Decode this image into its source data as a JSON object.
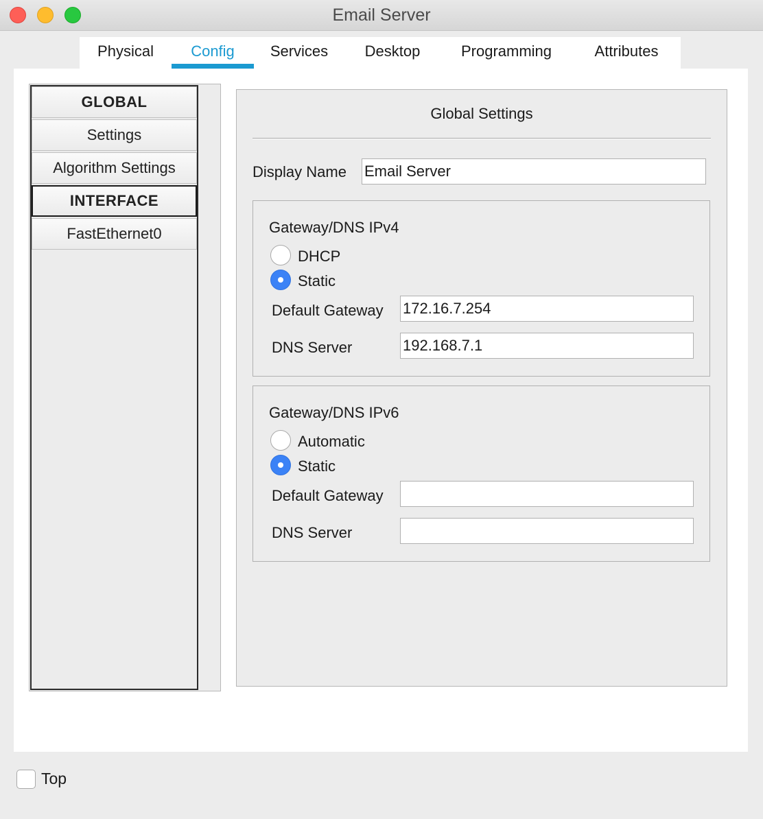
{
  "window": {
    "title": "Email Server",
    "colors": {
      "close": "#fe5f57",
      "minimize": "#febc2e",
      "maximize": "#28c840"
    }
  },
  "tabs": [
    {
      "label": "Physical",
      "active": false
    },
    {
      "label": "Config",
      "active": true
    },
    {
      "label": "Services",
      "active": false
    },
    {
      "label": "Desktop",
      "active": false
    },
    {
      "label": "Programming",
      "active": false
    },
    {
      "label": "Attributes",
      "active": false
    }
  ],
  "accent_color": "#1b9ad1",
  "sidebar": {
    "items": [
      {
        "label": "GLOBAL",
        "type": "header"
      },
      {
        "label": "Settings",
        "type": "item"
      },
      {
        "label": "Algorithm Settings",
        "type": "item"
      },
      {
        "label": "INTERFACE",
        "type": "header",
        "selected": true
      },
      {
        "label": "FastEthernet0",
        "type": "item"
      }
    ]
  },
  "global_settings": {
    "title": "Global Settings",
    "display_name_label": "Display Name",
    "display_name_value": "Email Server",
    "ipv4": {
      "title": "Gateway/DNS IPv4",
      "option_dhcp": "DHCP",
      "option_static": "Static",
      "selected": "Static",
      "default_gateway_label": "Default Gateway",
      "default_gateway_value": "172.16.7.254",
      "dns_server_label": "DNS Server",
      "dns_server_value": "192.168.7.1"
    },
    "ipv6": {
      "title": "Gateway/DNS IPv6",
      "option_automatic": "Automatic",
      "option_static": "Static",
      "selected": "Static",
      "default_gateway_label": "Default Gateway",
      "default_gateway_value": "",
      "dns_server_label": "DNS Server",
      "dns_server_value": ""
    }
  },
  "footer": {
    "top_label": "Top",
    "top_checked": false
  }
}
